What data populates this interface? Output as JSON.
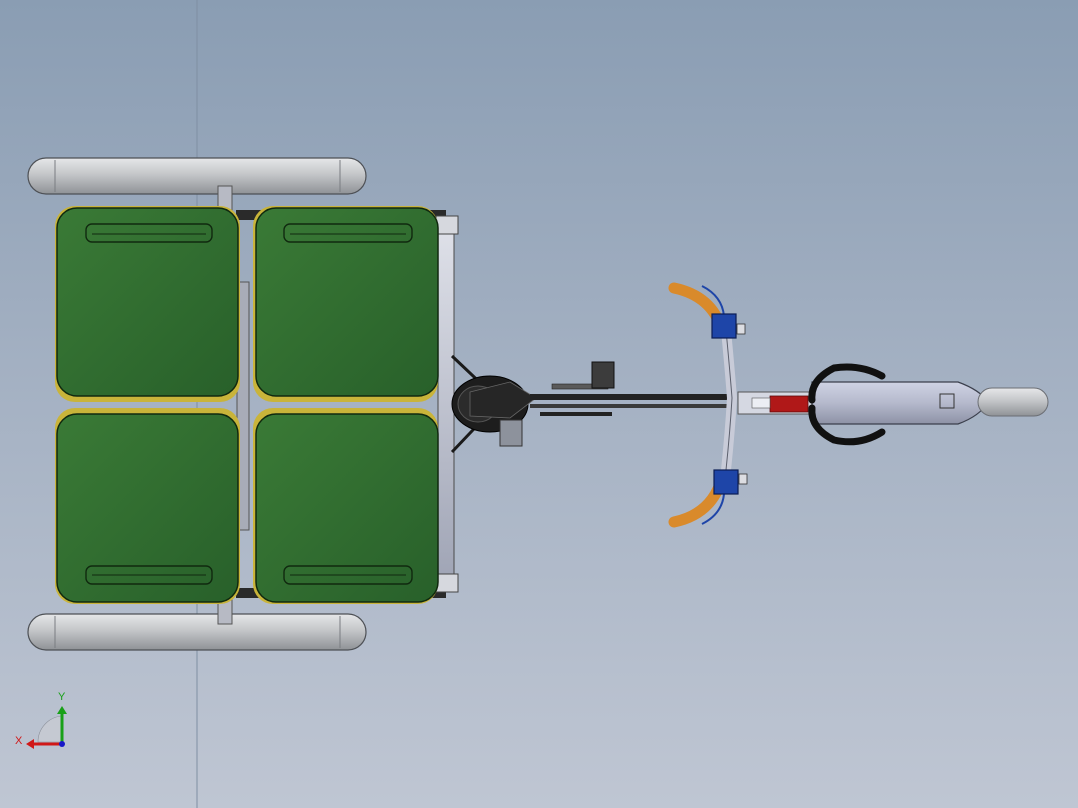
{
  "viewport": {
    "background_top": "#8a9db3",
    "background_bottom": "#bfc6d3"
  },
  "model": {
    "view": "top",
    "bins": [
      {
        "color": "#2f6a2c",
        "outline": "#10290f",
        "rim": "#c9b43a"
      },
      {
        "color": "#2f6a2c",
        "outline": "#10290f",
        "rim": "#c9b43a"
      },
      {
        "color": "#2f6a2c",
        "outline": "#10290f",
        "rim": "#c9b43a"
      },
      {
        "color": "#2f6a2c",
        "outline": "#10290f",
        "rim": "#c9b43a"
      }
    ],
    "pontoon_color": "#c7c9cc",
    "handlebar_grip_color": "#d98a2b",
    "lever_color": "#1e45a8",
    "accent_red": "#b01818"
  },
  "triad": {
    "x_label": "X",
    "y_label": "Y",
    "x_color": "#d01818",
    "y_color": "#18a018",
    "z_color": "#1818c8"
  }
}
